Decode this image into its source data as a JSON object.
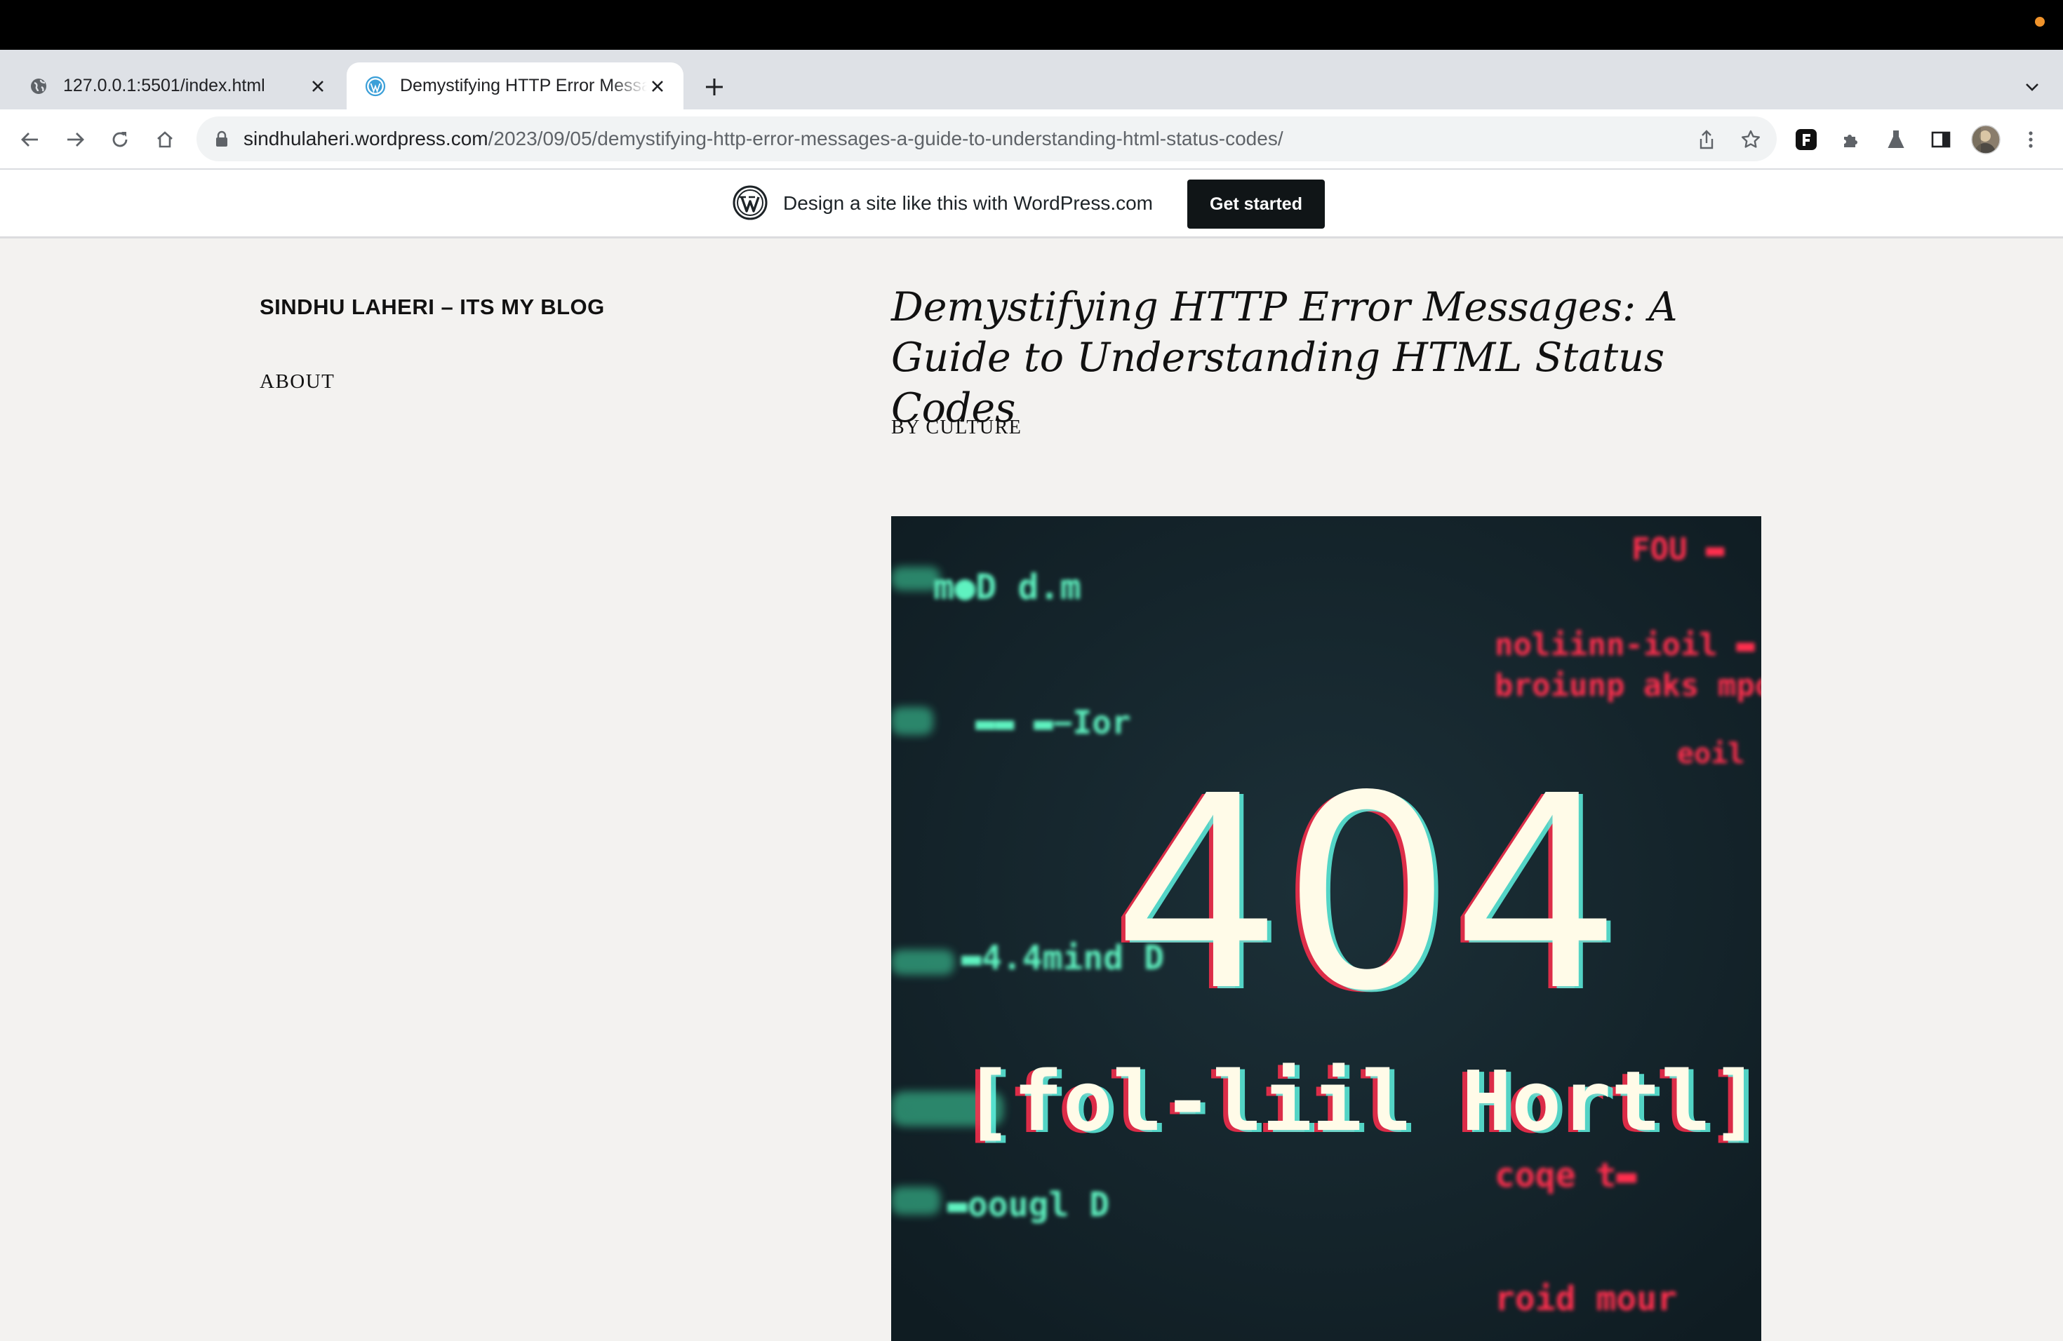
{
  "browser": {
    "tabs": [
      {
        "title": "127.0.0.1:5501/index.html",
        "favicon": "globe-icon",
        "active": false
      },
      {
        "title": "Demystifying HTTP Error Messages: A Guide to Understanding HTML Status Codes",
        "favicon": "wordpress-icon",
        "active": true
      }
    ],
    "url_host": "sindhulaheri.wordpress.com",
    "url_path": "/2023/09/05/demystifying-http-error-messages-a-guide-to-understanding-html-status-codes/",
    "toolbar_icons": [
      "back-icon",
      "forward-icon",
      "reload-icon",
      "home-icon",
      "share-icon",
      "bookmark-star-icon",
      "extension-f-icon",
      "extensions-puzzle-icon",
      "labs-flask-icon",
      "side-panel-icon",
      "profile-avatar",
      "kebab-menu-icon"
    ]
  },
  "banner": {
    "text": "Design a site like this with WordPress.com",
    "button_label": "Get started"
  },
  "site": {
    "title": "SINDHU LAHERI – ITS MY BLOG",
    "nav": [
      "ABOUT"
    ]
  },
  "post": {
    "title": "Demystifying HTTP Error Messages: A Guide to Understanding HTML Status Codes",
    "byline": "BY CULTURE",
    "image": {
      "big_text": "404",
      "sub_text": "[fol-liil Hortl]",
      "glitch_labels_green": [
        "m●D d.m",
        "▬▬ ▬−Ior",
        "▬4.4mind D",
        "▬oougl D"
      ],
      "glitch_labels_red": [
        "FOU ▬",
        "noliinn-ioil ▬",
        "broiunp aks mpo",
        "eoil",
        "coqe t▬",
        "roid mour"
      ]
    }
  },
  "colors": {
    "page_bg": "#f3f2f0",
    "tab_strip": "#dee1e6",
    "banner_button": "#101517",
    "image_bg": "#14232a",
    "glitch_green": "#5ef2c0",
    "glitch_red": "#ff2e4d",
    "big_text": "#fffbe8"
  }
}
